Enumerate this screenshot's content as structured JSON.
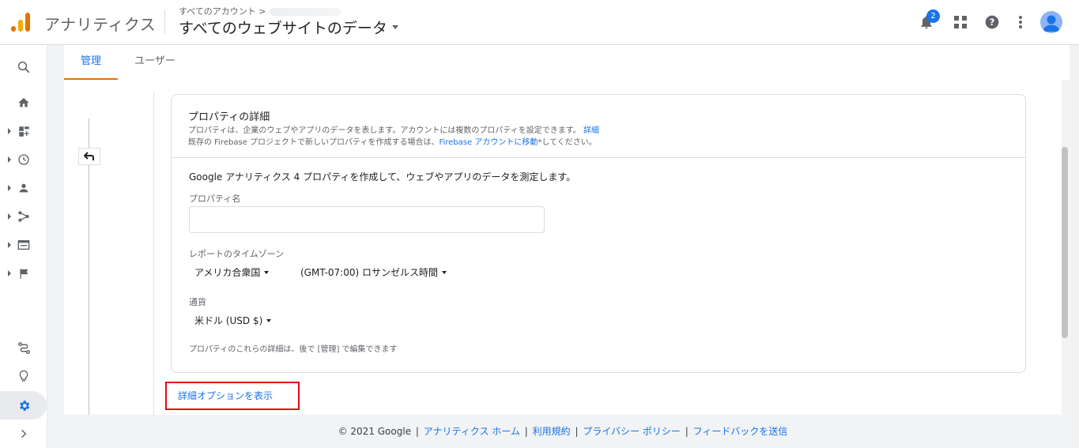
{
  "header": {
    "product_name": "アナリティクス",
    "account_crumb": "すべてのアカウント >",
    "view_title": "すべてのウェブサイトのデータ",
    "notification_count": "2"
  },
  "icons": {
    "search": "search-icon",
    "home": "home-icon",
    "customization": "dashboard-icon",
    "realtime": "clock-icon",
    "audience": "person-icon",
    "acquisition": "acquisition-icon",
    "behavior": "behavior-icon",
    "conversions": "flag-icon",
    "attribution": "route-icon",
    "discover": "lightbulb-icon",
    "admin": "gear-icon",
    "expand": "chevron-right-icon"
  },
  "tabs": [
    {
      "label": "管理"
    },
    {
      "label": "ユーザー"
    }
  ],
  "card": {
    "title": "プロパティの詳細",
    "desc1": "プロパティは、企業のウェブやアプリのデータを表します。アカウントには複数のプロパティを設定できます。",
    "desc1_link": "詳細",
    "desc2_pre": "既存の Firebase プロジェクトで新しいプロパティを作成する場合は、",
    "desc2_link": "Firebase アカウントに移動",
    "desc2_post": "*してください。",
    "intro": "Google アナリティクス 4 プロパティを作成して、ウェブやアプリのデータを測定します。",
    "property_name_label": "プロパティ名",
    "property_name_value": "",
    "timezone_label": "レポートのタイムゾーン",
    "country": "アメリカ合衆国",
    "timezone": "(GMT-07:00) ロサンゼルス時間",
    "currency_label": "通貨",
    "currency": "米ドル (USD $)",
    "hint": "プロパティのこれらの詳細は、後で [管理] で編集できます"
  },
  "advanced_link": "詳細オプションを表示",
  "footer": {
    "copyright": "© 2021 Google",
    "links": [
      "アナリティクス ホーム",
      "利用規約",
      "プライバシー ポリシー",
      "フィードバックを送信"
    ]
  },
  "colors": {
    "accent": "#1a73e8",
    "tab_indicator": "#e37400",
    "highlight_box": "#e50914"
  }
}
